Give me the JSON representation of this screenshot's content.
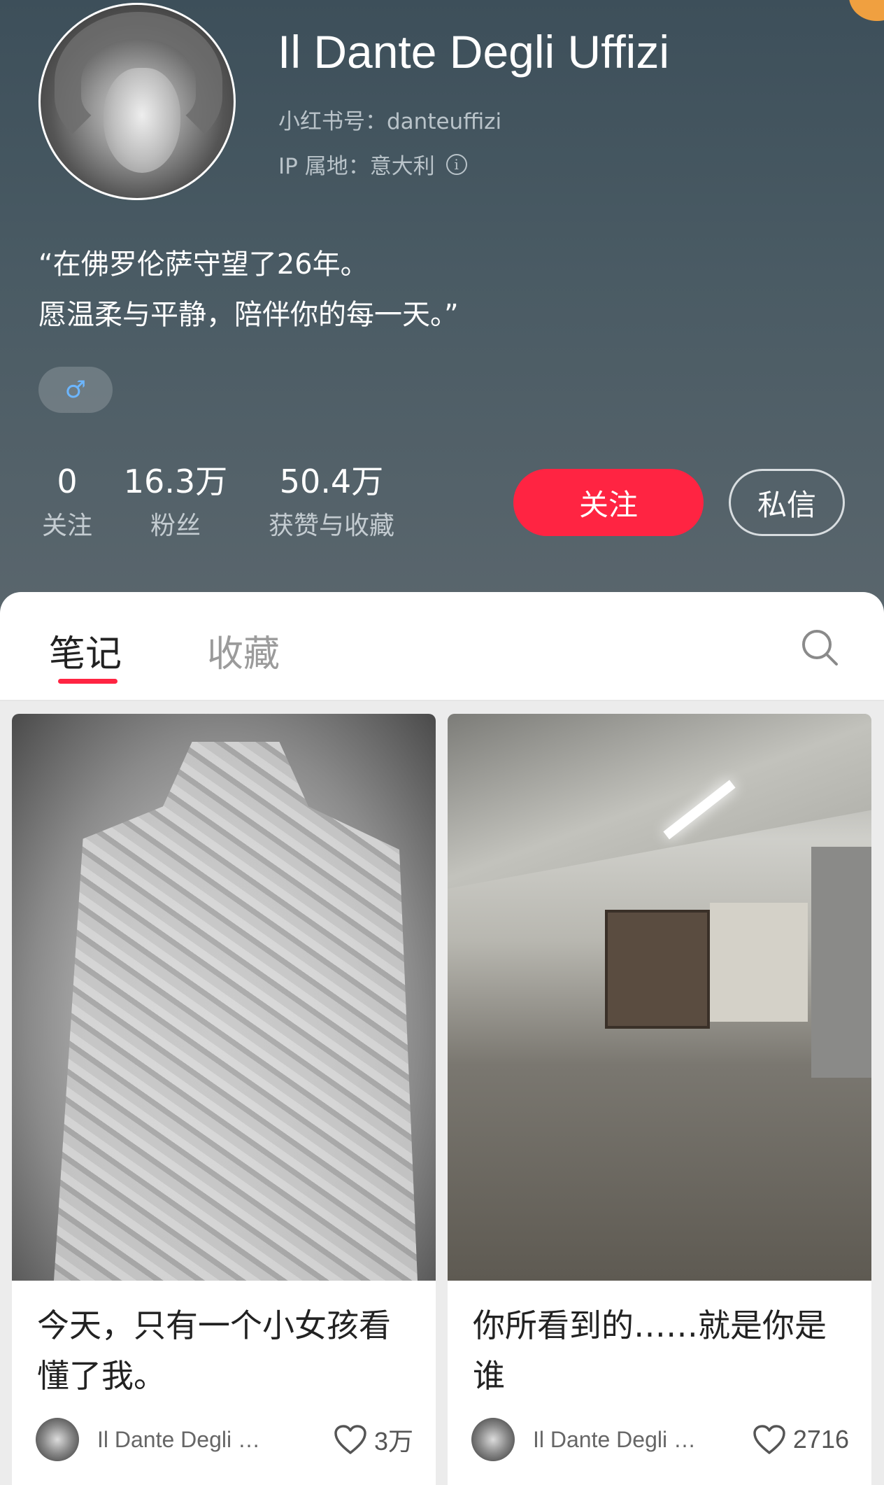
{
  "profile": {
    "name": "Il Dante Degli Uffizi",
    "red_id": "小红书号：danteuffizi",
    "ip_location": "IP 属地：意大利",
    "bio_line1": "“在佛罗伦萨守望了26年。",
    "bio_line2": "愿温柔与平静，陪伴你的每一天。”",
    "gender_symbol": "♂"
  },
  "stats": {
    "following": {
      "value": "0",
      "label": "关注"
    },
    "fans": {
      "value": "16.3万",
      "label": "粉丝"
    },
    "likes_collects": {
      "value": "50.4万",
      "label": "获赞与收藏"
    }
  },
  "actions": {
    "follow_label": "关注",
    "message_label": "私信"
  },
  "tabs": [
    {
      "label": "笔记",
      "active": true
    },
    {
      "label": "收藏",
      "active": false
    }
  ],
  "notes": [
    {
      "title": "今天，只有一个小女孩看懂了我。",
      "author": "Il Dante Degli …",
      "likes": "3万"
    },
    {
      "title": "你所看到的……就是你是谁",
      "author": "Il Dante Degli …",
      "likes": "2716"
    }
  ],
  "colors": {
    "accent": "#ff2442",
    "header_bg": "#4a5b64",
    "gender_icon": "#6cb6ff"
  },
  "icons": {
    "info": "info-icon",
    "search": "search-icon",
    "heart": "heart-icon"
  }
}
